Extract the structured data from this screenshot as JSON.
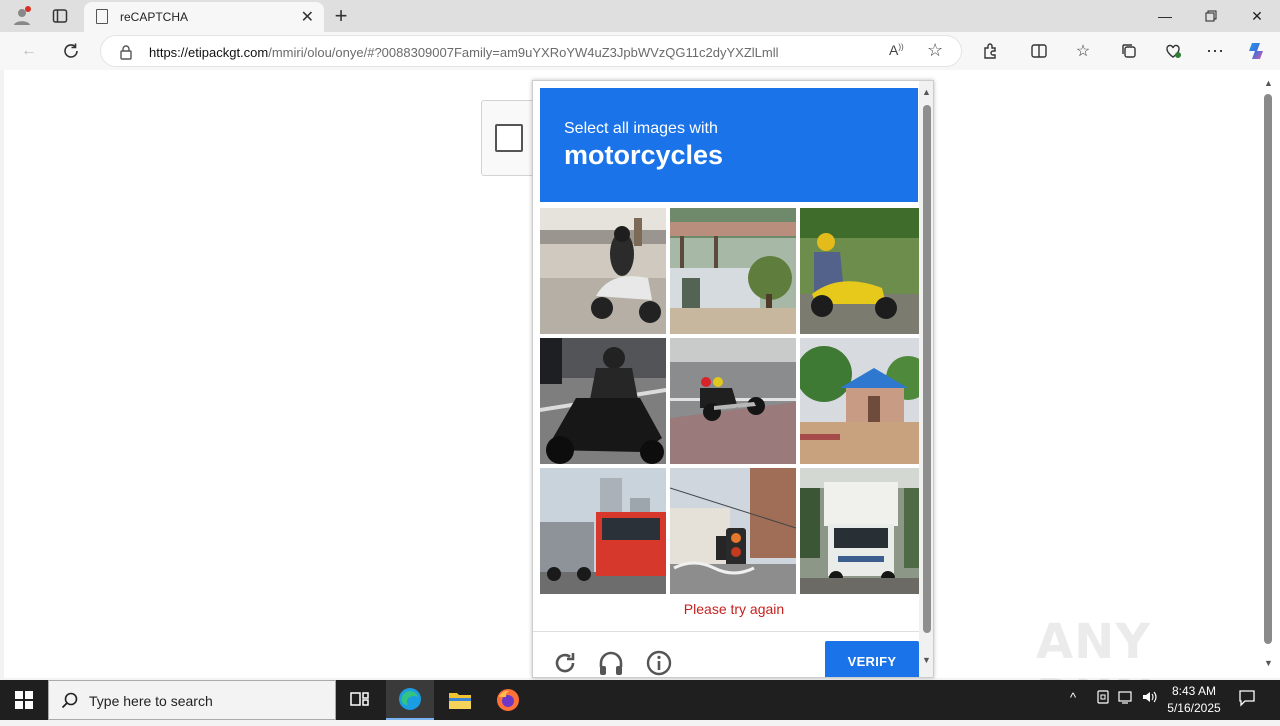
{
  "browser": {
    "tab_title": "reCAPTCHA",
    "url_domain": "https://etipackgt.com",
    "url_path": "/mmiri/olou/onye/#?0088309007Family=am9uYXRoYW4uZ3JpbWVzQG11c2dyYXZlLmll"
  },
  "captcha": {
    "instruction": "Select all images with",
    "target": "motorcycles",
    "error": "Please try again",
    "verify_label": "VERIFY",
    "tiles": [
      "motorcycle-rider-1",
      "roadside-shelter",
      "motorcycle-yellow",
      "motorcycle-black",
      "motorcycle-street",
      "house-blue-roof",
      "bus-street",
      "traffic-light",
      "truck-white"
    ]
  },
  "watermark": "ANY RUN",
  "taskbar": {
    "search_placeholder": "Type here to search",
    "time": "8:43 AM",
    "date": "5/16/2025"
  },
  "colors": {
    "accent": "#1a73e8",
    "error": "#c5221f"
  }
}
